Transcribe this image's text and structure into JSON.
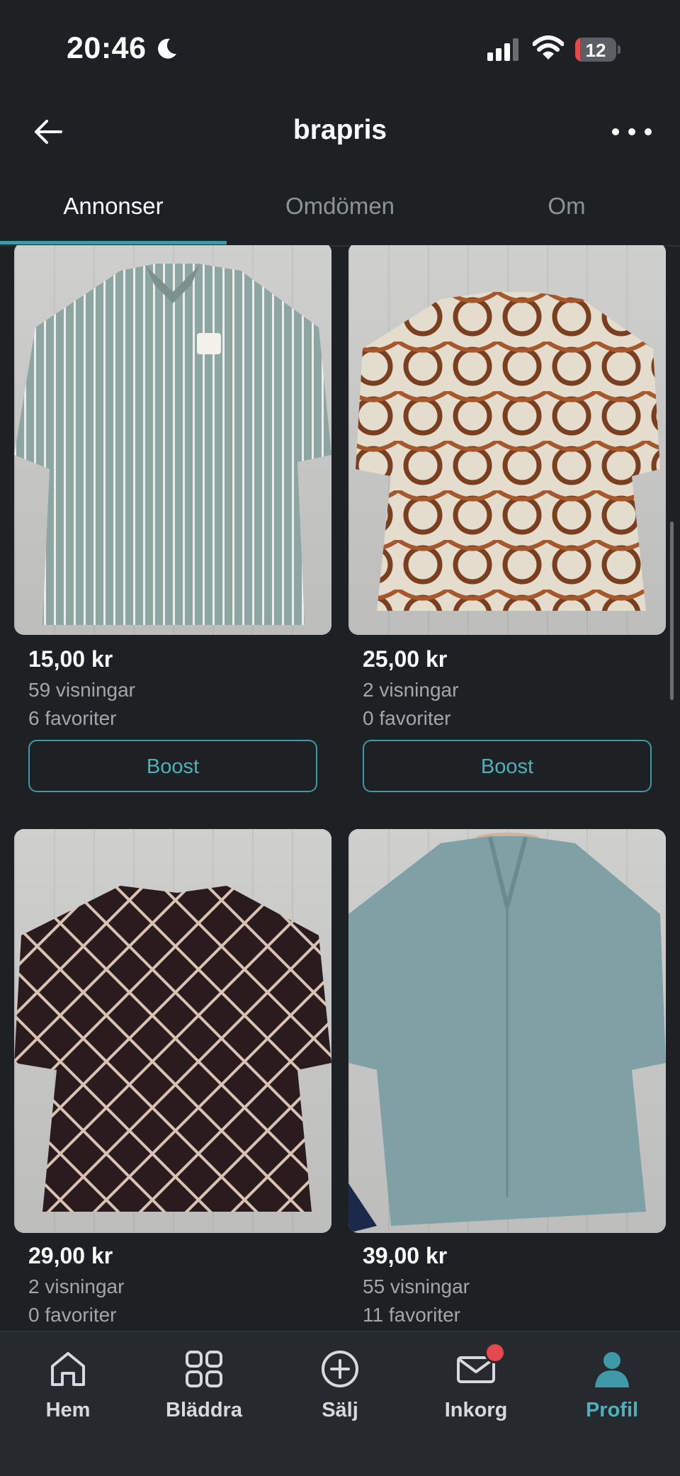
{
  "status_bar": {
    "time": "20:46",
    "battery": "12",
    "battery_level": 0.12
  },
  "header": {
    "title": "brapris"
  },
  "tabs": [
    {
      "label": "Annonser",
      "active": true
    },
    {
      "label": "Omdömen",
      "active": false
    },
    {
      "label": "Om",
      "active": false
    }
  ],
  "listings": [
    {
      "price": "15,00 kr",
      "views": "59 visningar",
      "favorites": "6 favoriter",
      "boost_label": "Boost"
    },
    {
      "price": "25,00 kr",
      "views": "2 visningar",
      "favorites": "0 favoriter",
      "boost_label": "Boost"
    },
    {
      "price": "29,00 kr",
      "views": "2 visningar",
      "favorites": "0 favoriter"
    },
    {
      "price": "39,00 kr",
      "views": "55 visningar",
      "favorites": "11 favoriter"
    }
  ],
  "bottom_nav": [
    {
      "label": "Hem",
      "icon": "home-icon"
    },
    {
      "label": "Bläddra",
      "icon": "grid-icon"
    },
    {
      "label": "Sälj",
      "icon": "plus-circle-icon"
    },
    {
      "label": "Inkorg",
      "icon": "mail-icon",
      "has_badge": true
    },
    {
      "label": "Profil",
      "icon": "person-icon",
      "active": true
    }
  ],
  "colors": {
    "background": "#1d2124",
    "accent": "#3d9aa6",
    "badge": "#e5484d"
  }
}
